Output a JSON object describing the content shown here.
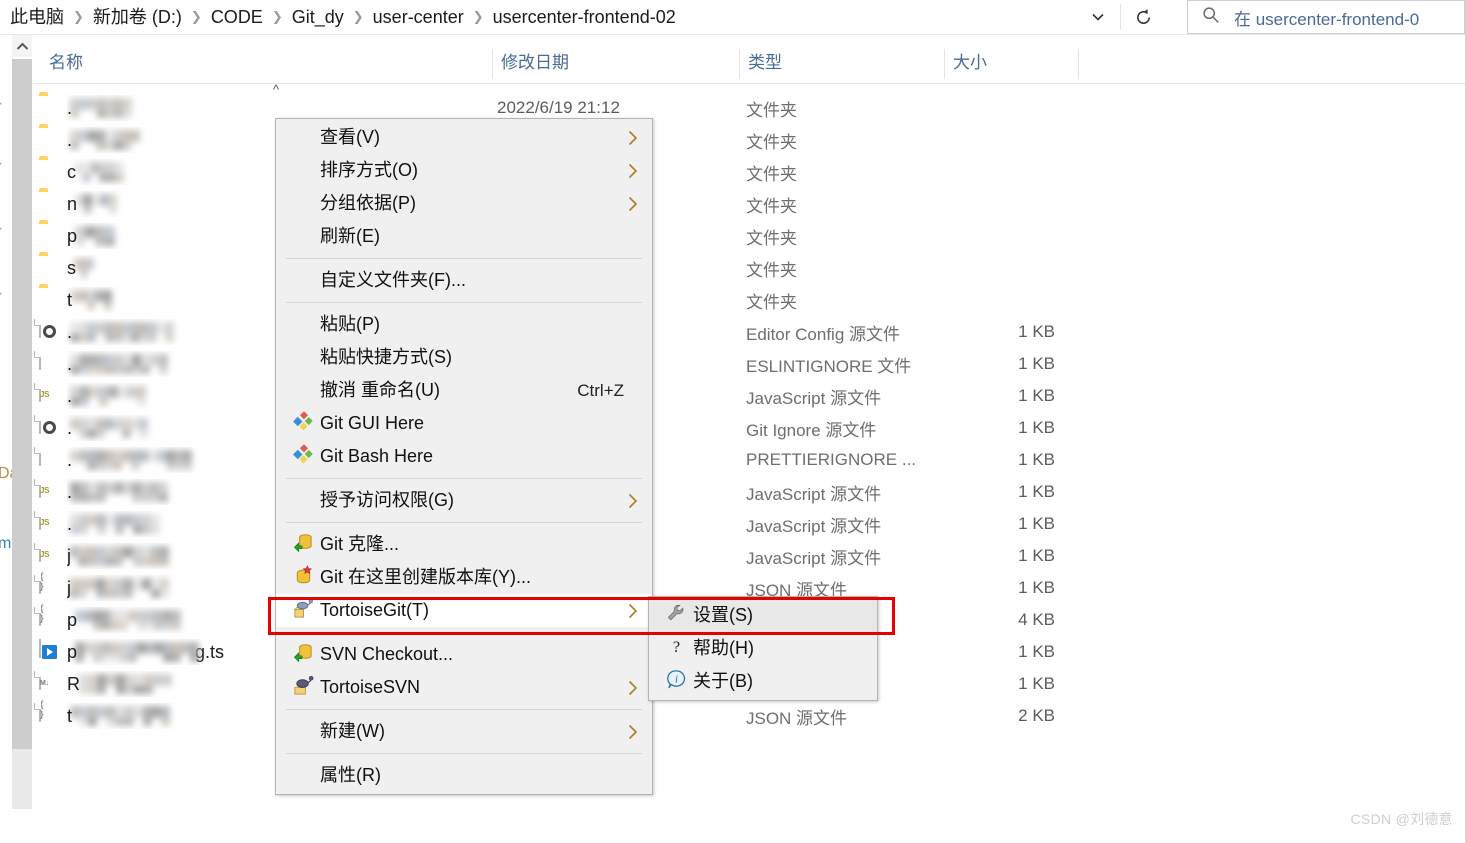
{
  "window": {
    "breadcrumb": {
      "items": [
        "此电脑",
        "新加卷 (D:)",
        "CODE",
        "Git_dy",
        "user-center",
        "usercenter-frontend-02"
      ],
      "separator": "❯"
    },
    "toolbar": {
      "history_dropdown_icon": "chevron-down-icon",
      "refresh_icon": "refresh-icon"
    },
    "search": {
      "icon": "search-icon",
      "placeholder": "在 usercenter-frontend-0"
    }
  },
  "columns": {
    "name": "名称",
    "date_modified": "修改日期",
    "type": "类型",
    "size": "大小",
    "sort_indicator": "^"
  },
  "files": [
    {
      "icon": "folder",
      "name_head": ".",
      "blur_w": 62,
      "date": "2022/6/19 21:12",
      "type": "文件夹",
      "size": ""
    },
    {
      "icon": "folder",
      "name_head": ".",
      "blur_w": 70,
      "date": "",
      "type": "文件夹",
      "size": ""
    },
    {
      "icon": "folder",
      "name_head": "c",
      "blur_w": 50,
      "date": "",
      "type": "文件夹",
      "size": ""
    },
    {
      "icon": "folder",
      "name_head": "n",
      "blur_w": 42,
      "date": "",
      "type": "文件夹",
      "size": ""
    },
    {
      "icon": "folder",
      "name_head": "p",
      "blur_w": 40,
      "date": "",
      "type": "文件夹",
      "size": ""
    },
    {
      "icon": "folder",
      "name_head": "s",
      "blur_w": 20,
      "date": "",
      "type": "文件夹",
      "size": ""
    },
    {
      "icon": "folder",
      "name_head": "t",
      "blur_w": 42,
      "date": "",
      "type": "文件夹",
      "size": ""
    },
    {
      "icon": "config",
      "name_head": ".",
      "blur_w": 104,
      "date": "",
      "type": "Editor Config 源文件",
      "size": "1 KB"
    },
    {
      "icon": "blank",
      "name_head": ".",
      "blur_w": 98,
      "date": "",
      "type": "ESLINTIGNORE 文件",
      "size": "1 KB"
    },
    {
      "icon": "js",
      "name_head": ".",
      "blur_w": 76,
      "date": "",
      "type": "JavaScript 源文件",
      "size": "1 KB"
    },
    {
      "icon": "config",
      "name_head": ".",
      "blur_w": 78,
      "date": "",
      "type": "Git Ignore 源文件",
      "size": "1 KB"
    },
    {
      "icon": "blank",
      "name_head": ".",
      "blur_w": 122,
      "date": "",
      "type": "PRETTIERIGNORE ...",
      "size": "1 KB"
    },
    {
      "icon": "js",
      "name_head": ".",
      "blur_w": 98,
      "date": "",
      "type": "JavaScript 源文件",
      "size": "1 KB"
    },
    {
      "icon": "js",
      "name_head": ".",
      "blur_w": 90,
      "date": "",
      "type": "JavaScript 源文件",
      "size": "1 KB"
    },
    {
      "icon": "js",
      "name_head": "j",
      "blur_w": 100,
      "date": "",
      "type": "JavaScript 源文件",
      "size": "1 KB"
    },
    {
      "icon": "brace",
      "name_head": "j",
      "blur_w": 100,
      "date": "",
      "type": "JSON 源文件",
      "size": "1 KB"
    },
    {
      "icon": "brace",
      "name_head": "p",
      "blur_w": 106,
      "date": "",
      "type": "",
      "size": "4 KB"
    },
    {
      "icon": "media",
      "name_head": "p",
      "blur_w": 124,
      "name_tail": "g.ts",
      "date": "",
      "type": "",
      "size": "1 KB"
    },
    {
      "icon": "md",
      "name_head": "R",
      "blur_w": 94,
      "date": "",
      "type": "",
      "size": "1 KB"
    },
    {
      "icon": "brace",
      "name_head": "t",
      "blur_w": 100,
      "date": "",
      "type": "JSON 源文件",
      "size": "2 KB"
    }
  ],
  "context_menu": {
    "items": [
      {
        "label": "查看(V)",
        "icon": "",
        "arrow": true,
        "accel": "",
        "type": "item"
      },
      {
        "label": "排序方式(O)",
        "icon": "",
        "arrow": true,
        "accel": "",
        "type": "item"
      },
      {
        "label": "分组依据(P)",
        "icon": "",
        "arrow": true,
        "accel": "",
        "type": "item"
      },
      {
        "label": "刷新(E)",
        "icon": "",
        "arrow": false,
        "accel": "",
        "type": "item"
      },
      {
        "label": "",
        "type": "separator"
      },
      {
        "label": "自定义文件夹(F)...",
        "icon": "",
        "arrow": false,
        "accel": "",
        "type": "item"
      },
      {
        "label": "",
        "type": "separator"
      },
      {
        "label": "粘贴(P)",
        "icon": "",
        "arrow": false,
        "accel": "",
        "type": "item"
      },
      {
        "label": "粘贴快捷方式(S)",
        "icon": "",
        "arrow": false,
        "accel": "",
        "type": "item"
      },
      {
        "label": "撤消 重命名(U)",
        "icon": "",
        "arrow": false,
        "accel": "Ctrl+Z",
        "type": "item"
      },
      {
        "label": "Git GUI Here",
        "icon": "git-logo-icon",
        "arrow": false,
        "accel": "",
        "type": "item"
      },
      {
        "label": "Git Bash Here",
        "icon": "git-logo-icon",
        "arrow": false,
        "accel": "",
        "type": "item"
      },
      {
        "label": "",
        "type": "separator"
      },
      {
        "label": "授予访问权限(G)",
        "icon": "",
        "arrow": true,
        "accel": "",
        "type": "item"
      },
      {
        "label": "",
        "type": "separator"
      },
      {
        "label": "Git 克隆...",
        "icon": "git-clone-icon",
        "arrow": false,
        "accel": "",
        "type": "item"
      },
      {
        "label": "Git 在这里创建版本库(Y)...",
        "icon": "git-create-repo-icon",
        "arrow": false,
        "accel": "",
        "type": "item"
      },
      {
        "label": "TortoiseGit(T)",
        "icon": "tortoisegit-icon",
        "arrow": true,
        "accel": "",
        "type": "item",
        "highlighted": true
      },
      {
        "label": "",
        "type": "separator"
      },
      {
        "label": "SVN Checkout...",
        "icon": "svn-checkout-icon",
        "arrow": false,
        "accel": "",
        "type": "item"
      },
      {
        "label": "TortoiseSVN",
        "icon": "tortoisesvn-icon",
        "arrow": true,
        "accel": "",
        "type": "item"
      },
      {
        "label": "",
        "type": "separator"
      },
      {
        "label": "新建(W)",
        "icon": "",
        "arrow": true,
        "accel": "",
        "type": "item"
      },
      {
        "label": "",
        "type": "separator"
      },
      {
        "label": "属性(R)",
        "icon": "",
        "arrow": false,
        "accel": "",
        "type": "item"
      }
    ]
  },
  "submenu": {
    "items": [
      {
        "label": "设置(S)",
        "icon": "wrench-icon",
        "highlighted": true
      },
      {
        "label": "帮助(H)",
        "icon": "question-icon",
        "highlighted": false
      },
      {
        "label": "关于(B)",
        "icon": "info-icon",
        "highlighted": false
      }
    ]
  },
  "annotation": {
    "highlight_color": "#e60000"
  },
  "watermark": "CSDN @刘德意"
}
